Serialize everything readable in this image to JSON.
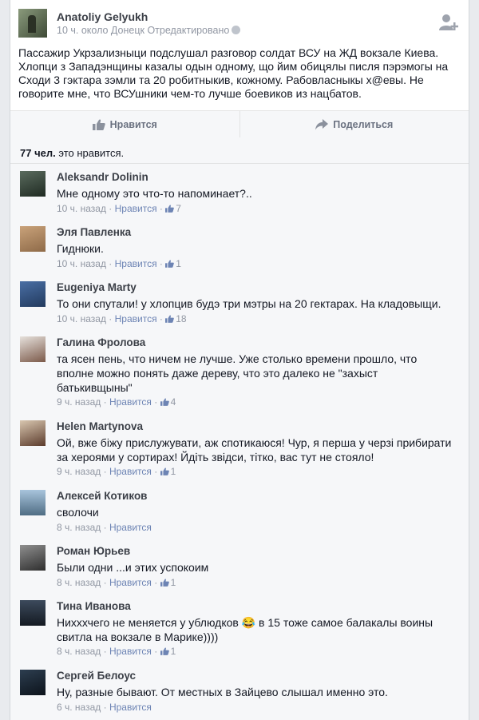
{
  "post": {
    "author": "Anatoliy Gelyukh",
    "meta": "10 ч. около Донецк Отредактировано",
    "text": "Пассажир Укрзализныци подслушал разговор солдат ВСУ на ЖД вокзале Киева. Хлопци з Западэнщины казалы одын одному, що йим обицялы писля пэрэмогы на Сходи 3 гэктара зэмли та 20 робитныкив, кожному. Рабовласныкы х@евы. Не говорите мне, что ВСУшники чем-то лучше боевиков из нацбатов.",
    "like_label": "Нравится",
    "share_label": "Поделиться"
  },
  "likes_summary": {
    "count": "77 чел.",
    "text": " это нравится."
  },
  "comments": [
    {
      "author": "Aleksandr Dolinin",
      "text": "Мне одному это что-то напоминает?..",
      "time": "10 ч. назад",
      "like_label": "Нравится",
      "likes": "7"
    },
    {
      "author": "Эля Павленка",
      "text": "Гиднюки.",
      "time": "10 ч. назад",
      "like_label": "Нравится",
      "likes": "1"
    },
    {
      "author": "Eugeniya Marty",
      "text": "То они спутали! у хлопцив будэ три мэтры на 20 гектарах. На кладовыщи.",
      "time": "10 ч. назад",
      "like_label": "Нравится",
      "likes": "18"
    },
    {
      "author": "Галина Фролова",
      "text": "та ясен пень, что ничем не лучше. Уже столько времени прошло, что вполне можно понять даже дереву, что это далеко не \"захыст батькивщыны\"",
      "time": "9 ч. назад",
      "like_label": "Нравится",
      "likes": "4"
    },
    {
      "author": "Helen Martynova",
      "text": "Ой, вже біжу прислужувати, аж спотикаюся! Чур, я перша у черзі прибирати за хероями у сортирах! Йдіть звідси, тітко, вас тут не стояло!",
      "time": "9 ч. назад",
      "like_label": "Нравится",
      "likes": "1"
    },
    {
      "author": "Алексей Котиков",
      "text": "сволочи",
      "time": "8 ч. назад",
      "like_label": "Нравится",
      "likes": ""
    },
    {
      "author": "Роман Юрьев",
      "text": "Были одни ...и этих успокоим",
      "time": "8 ч. назад",
      "like_label": "Нравится",
      "likes": "1"
    },
    {
      "author": "Тина Иванова",
      "text": "Нихххчего не меняется у ублюдков 😂 в 15 тоже самое балакалы воины свитла на вокзале в Марике))))",
      "time": "8 ч. назад",
      "like_label": "Нравится",
      "likes": "1"
    },
    {
      "author": "Сергей Белоус",
      "text": "Ну, разные бывают. От местных в Зайцево слышал именно это.",
      "time": "6 ч. назад",
      "like_label": "Нравится",
      "likes": ""
    }
  ],
  "icons": {
    "add_friend": "add-friend-icon",
    "globe": "globe-icon",
    "like": "thumbs-up-icon",
    "share": "share-arrow-icon"
  },
  "colors": {
    "link": "#6d84b4",
    "meta": "#9197a3",
    "background": "#e9ebee"
  }
}
